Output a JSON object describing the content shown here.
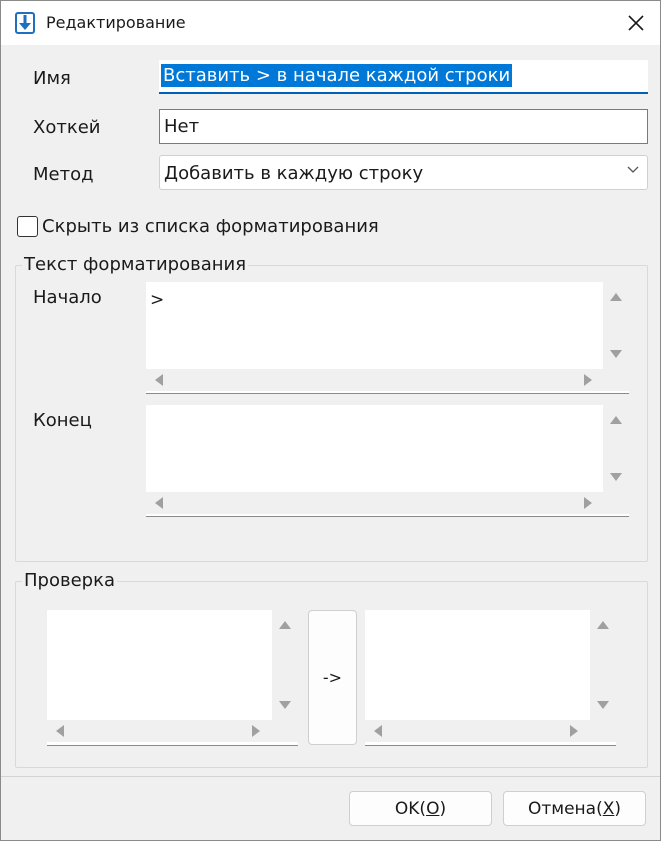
{
  "window": {
    "title": "Редактирование"
  },
  "form": {
    "name_label": "Имя",
    "name_value": "Вставить > в начале каждой строки",
    "hotkey_label": "Хоткей",
    "hotkey_value": "Нет",
    "method_label": "Метод",
    "method_value": "Добавить в каждую строку",
    "hide_checkbox_label": "Скрыть из списка форматирования",
    "hide_checked": false
  },
  "format_group": {
    "title": "Текст форматирования",
    "start_label": "Начало",
    "start_value": ">",
    "end_label": "Конец",
    "end_value": ""
  },
  "check_group": {
    "title": "Проверка",
    "input_value": "",
    "convert_label": "->",
    "output_value": ""
  },
  "footer": {
    "ok_text": "OK(",
    "ok_key": "O",
    "ok_close": ")",
    "cancel_text": "Отмена(",
    "cancel_key": "X",
    "cancel_close": ")"
  },
  "colors": {
    "accent": "#005fb8",
    "selection": "#0078d7",
    "icon": "#1e6fc2"
  }
}
